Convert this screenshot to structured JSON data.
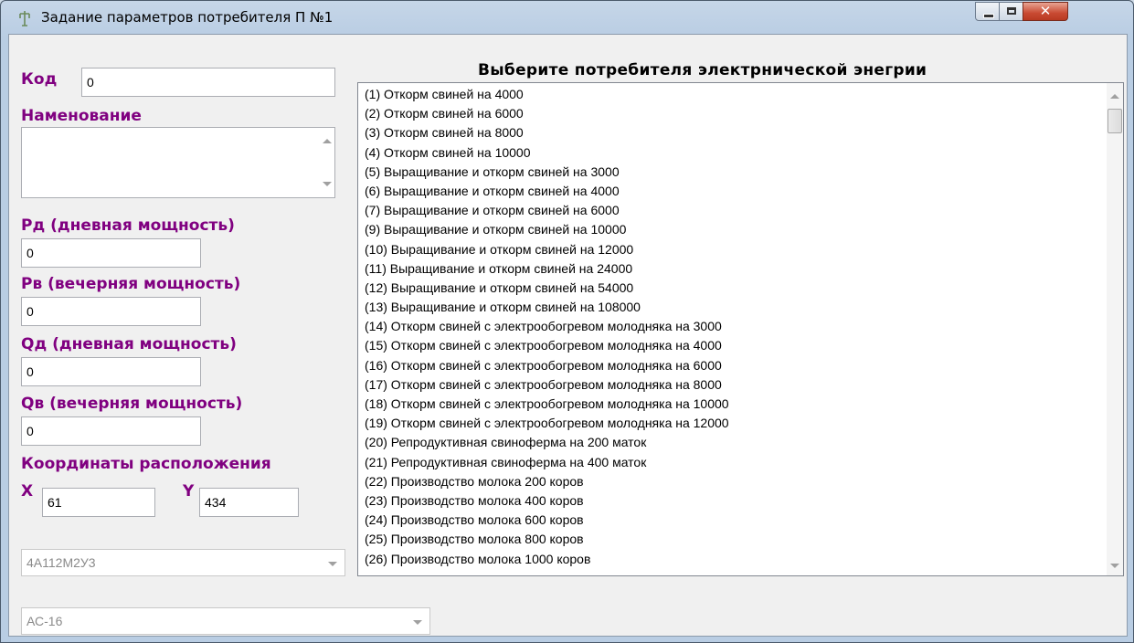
{
  "window": {
    "title": "Задание параметров потребителя П №1",
    "accent_color": "#800080"
  },
  "form": {
    "code_label": "Код",
    "code_value": "0",
    "name_label": "Наменование",
    "name_value": "",
    "pd_label": "Рд (дневная мощность)",
    "pd_value": "0",
    "pv_label": "Рв (вечерняя мощность)",
    "pv_value": "0",
    "qd_label": "Qд (дневная мощность)",
    "qd_value": "0",
    "qv_label": "Qв (вечерняя мощность)",
    "qv_value": "0",
    "coords_label": "Координаты расположения",
    "x_label": "X",
    "x_value": "61",
    "y_label": "Y",
    "y_value": "434",
    "motor_combo_value": "4А112М2У3",
    "wire_combo_value": "АС-16"
  },
  "list": {
    "heading": "Выберите потребителя электрнической энегрии",
    "items": [
      "(1) Откорм свиней на 4000",
      "(2) Откорм свиней на 6000",
      "(3) Откорм свиней на 8000",
      "(4) Откорм свиней на 10000",
      "(5) Выращивание и откорм свиней на 3000",
      "(6) Выращивание и откорм свиней на 4000",
      "(7) Выращивание и откорм свиней на 6000",
      "(9) Выращивание и откорм свиней на 10000",
      "(10) Выращивание и откорм свиней на 12000",
      "(11) Выращивание и откорм свиней на 24000",
      "(12) Выращивание и откорм свиней на 54000",
      "(13) Выращивание и откорм свиней на 108000",
      "(14) Откорм свиней с электрообогревом молодняка на 3000",
      "(15) Откорм свиней с электрообогревом молодняка на 4000",
      "(16) Откорм свиней с электрообогревом молодняка на 6000",
      "(17) Откорм свиней с электрообогревом молодняка на 8000",
      "(18) Откорм свиней с электрообогревом молодняка на 10000",
      "(19) Откорм свиней с электрообогревом молодняка на 12000",
      "(20) Репродуктивная свиноферма на 200 маток",
      "(21) Репродуктивная свиноферма на 400 маток",
      "(22) Производство молока 200 коров",
      "(23) Производство молока 400 коров",
      "(24) Производство молока 600 коров",
      "(25) Производство молока 800 коров",
      "(26) Производство молока 1000 коров"
    ]
  }
}
